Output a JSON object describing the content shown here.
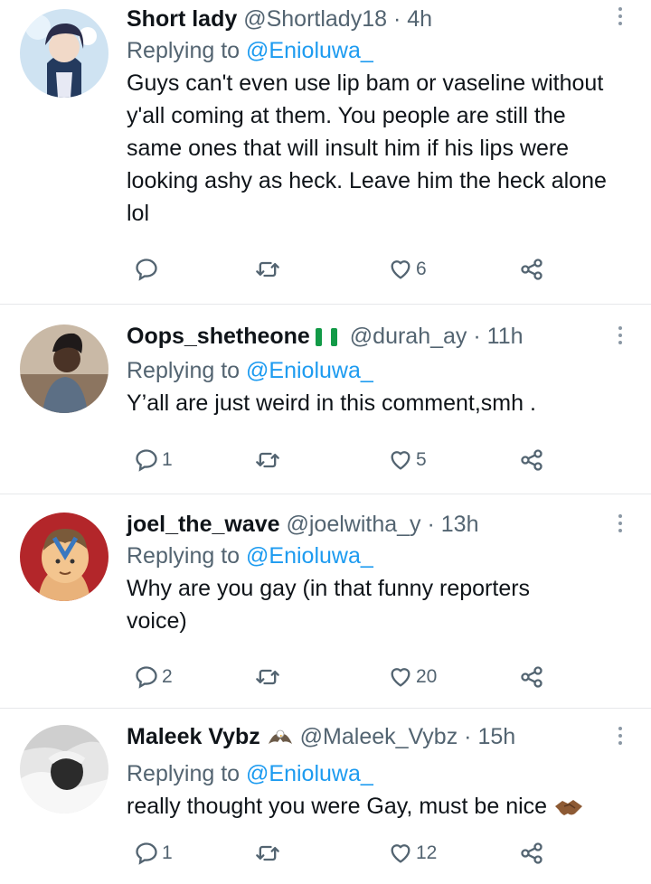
{
  "tweets": [
    {
      "name": "Short lady",
      "badge": "",
      "handle": "@Shortlady18",
      "time": "4h",
      "replying_prefix": "Replying to",
      "replying_to": "@Enioluwa_",
      "text": "Guys can't even use lip bam or vaseline without y'all coming at them. You people are still the same ones that will insult him if his lips were looking ashy as heck. Leave him the heck alone lol",
      "replies": "",
      "retweets": "",
      "likes": "6"
    },
    {
      "name": "Oops_shetheone",
      "badge": "nigeria-flag",
      "handle": "@durah_ay",
      "time": "11h",
      "replying_prefix": "Replying to",
      "replying_to": "@Enioluwa_",
      "text": "Y’all are just weird in this comment,smh .",
      "replies": "1",
      "retweets": "",
      "likes": "5"
    },
    {
      "name": "joel_the_wave",
      "badge": "",
      "handle": "@joelwitha_y",
      "time": "13h",
      "replying_prefix": "Replying to",
      "replying_to": "@Enioluwa_",
      "text": "Why are you gay (in that funny reporters voice)",
      "replies": "2",
      "retweets": "",
      "likes": "20"
    },
    {
      "name": "Maleek Vybz",
      "badge": "eagle-emoji",
      "handle": "@Maleek_Vybz",
      "time": "15h",
      "replying_prefix": "Replying to",
      "replying_to": "@Enioluwa_",
      "text": "really thought you were Gay, must be nice",
      "replies": "1",
      "retweets": "",
      "likes": "12"
    }
  ],
  "separator": "·",
  "colors": {
    "text": "#0f1419",
    "secondary": "#536471",
    "mention": "#1d9bf0",
    "divider": "#e6e8ea"
  },
  "icons": [
    "reply-icon",
    "retweet-icon",
    "like-icon",
    "share-icon",
    "more-options-icon",
    "handshake-emoji"
  ]
}
